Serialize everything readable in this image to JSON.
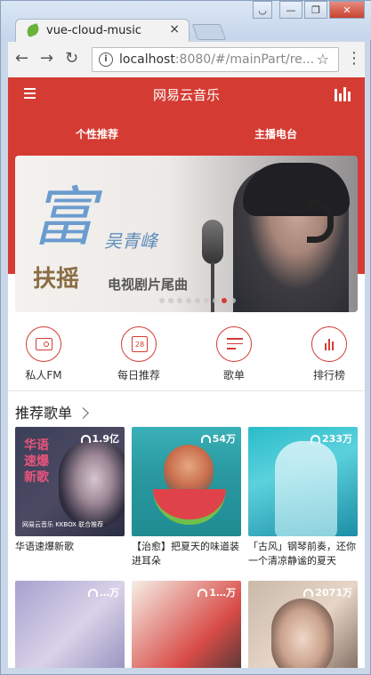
{
  "browser": {
    "tab_title": "vue-cloud-music",
    "tab_close": "×",
    "url_host": "localhost",
    "url_rest": ":8080/#/mainPart/re...",
    "back": "←",
    "forward": "→",
    "reload": "↻",
    "star": "☆",
    "menu": "⋮",
    "win_minimize": "—",
    "win_maximize": "❐",
    "win_close": "✕"
  },
  "app": {
    "title": "网易云音乐",
    "accent": "#d43c33"
  },
  "tabs": [
    {
      "label": "个性推荐"
    },
    {
      "label": "主播电台"
    }
  ],
  "banner": {
    "big_char": "富",
    "signature": "吴青峰",
    "title": "扶摇",
    "subtitle": "电视剧片尾曲",
    "dot_count": 9,
    "active_dot": 8
  },
  "quick_links": [
    {
      "label": "私人FM",
      "icon": "radio-icon"
    },
    {
      "label": "每日推荐",
      "icon": "calendar-icon",
      "icon_text": "28"
    },
    {
      "label": "歌单",
      "icon": "playlist-icon"
    },
    {
      "label": "排行榜",
      "icon": "rank-icon"
    }
  ],
  "section": {
    "title": "推荐歌单"
  },
  "playlists": [
    {
      "count": "1.9亿",
      "caption": "华语速爆新歌",
      "cover_text": "华语\n速爆\n新歌",
      "cover_logo": "网易云音乐 KKBOX 联合推荐"
    },
    {
      "count": "54万",
      "caption": "【治愈】把夏天的味道装进耳朵"
    },
    {
      "count": "233万",
      "caption": "「古风」钢琴前奏，还你一个清凉静谧的夏天"
    },
    {
      "count": "…万",
      "caption": ""
    },
    {
      "count": "1…万",
      "caption": ""
    },
    {
      "count": "2071万",
      "caption": ""
    }
  ]
}
